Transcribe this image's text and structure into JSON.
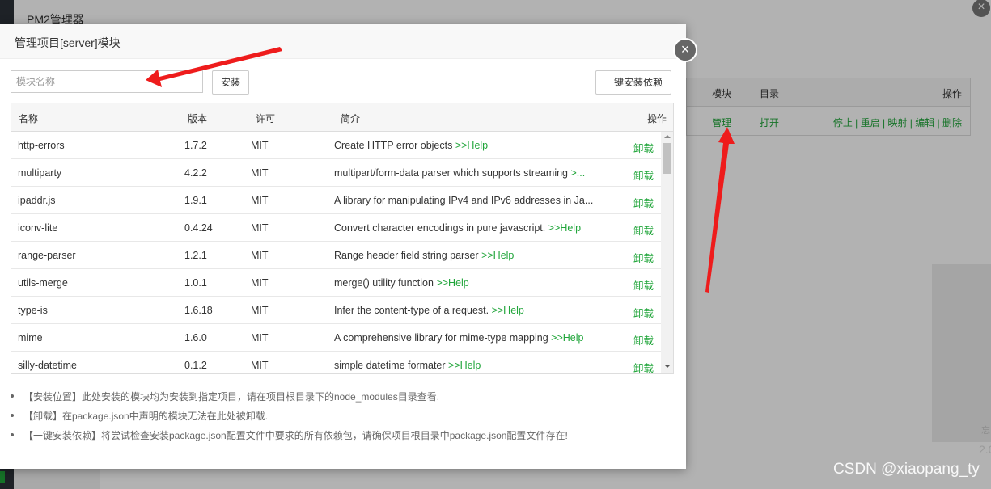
{
  "background": {
    "window_title": "PM2管理器",
    "table_headers": {
      "module": "模块",
      "dir": "目录",
      "ops": "操作"
    },
    "row": {
      "module": "管理",
      "dir": "打开",
      "ops": "停止 | 重启 | 映射 | 编辑 | 删除"
    },
    "fragment_1": "忘",
    "fragment_2": "2.0"
  },
  "modal": {
    "title": "管理项目[server]模块",
    "search_placeholder": "模块名称",
    "install_label": "安装",
    "oneclick_label": "一键安装依赖",
    "columns": {
      "name": "名称",
      "version": "版本",
      "license": "许可",
      "desc": "简介",
      "ops": "操作"
    },
    "rows": [
      {
        "name": "http-errors",
        "version": "1.7.2",
        "license": "MIT",
        "desc": "Create HTTP error objects ",
        "help": ">>Help",
        "op": "卸载"
      },
      {
        "name": "multiparty",
        "version": "4.2.2",
        "license": "MIT",
        "desc": "multipart/form-data parser which supports streaming ",
        "help": ">...",
        "op": "卸载"
      },
      {
        "name": "ipaddr.js",
        "version": "1.9.1",
        "license": "MIT",
        "desc": "A library for manipulating IPv4 and IPv6 addresses in Ja...",
        "help": "",
        "op": "卸载"
      },
      {
        "name": "iconv-lite",
        "version": "0.4.24",
        "license": "MIT",
        "desc": "Convert character encodings in pure javascript. ",
        "help": ">>Help",
        "op": "卸载"
      },
      {
        "name": "range-parser",
        "version": "1.2.1",
        "license": "MIT",
        "desc": "Range header field string parser ",
        "help": ">>Help",
        "op": "卸载"
      },
      {
        "name": "utils-merge",
        "version": "1.0.1",
        "license": "MIT",
        "desc": "merge() utility function ",
        "help": ">>Help",
        "op": "卸载"
      },
      {
        "name": "type-is",
        "version": "1.6.18",
        "license": "MIT",
        "desc": "Infer the content-type of a request. ",
        "help": ">>Help",
        "op": "卸载"
      },
      {
        "name": "mime",
        "version": "1.6.0",
        "license": "MIT",
        "desc": "A comprehensive library for mime-type mapping ",
        "help": ">>Help",
        "op": "卸载"
      },
      {
        "name": "silly-datetime",
        "version": "0.1.2",
        "license": "MIT",
        "desc": "simple datetime formater ",
        "help": ">>Help",
        "op": "卸载"
      }
    ],
    "notes": [
      "【安装位置】此处安装的模块均为安装到指定项目，请在项目根目录下的node_modules目录查看.",
      "【卸载】在package.json中声明的模块无法在此处被卸载.",
      "【一键安装依赖】将尝试检查安装package.json配置文件中要求的所有依赖包，请确保项目根目录中package.json配置文件存在!"
    ]
  },
  "watermark": "CSDN @xiaopang_ty",
  "colors": {
    "accent_green": "#20a53a",
    "annotation_red": "#ee1c1c"
  }
}
